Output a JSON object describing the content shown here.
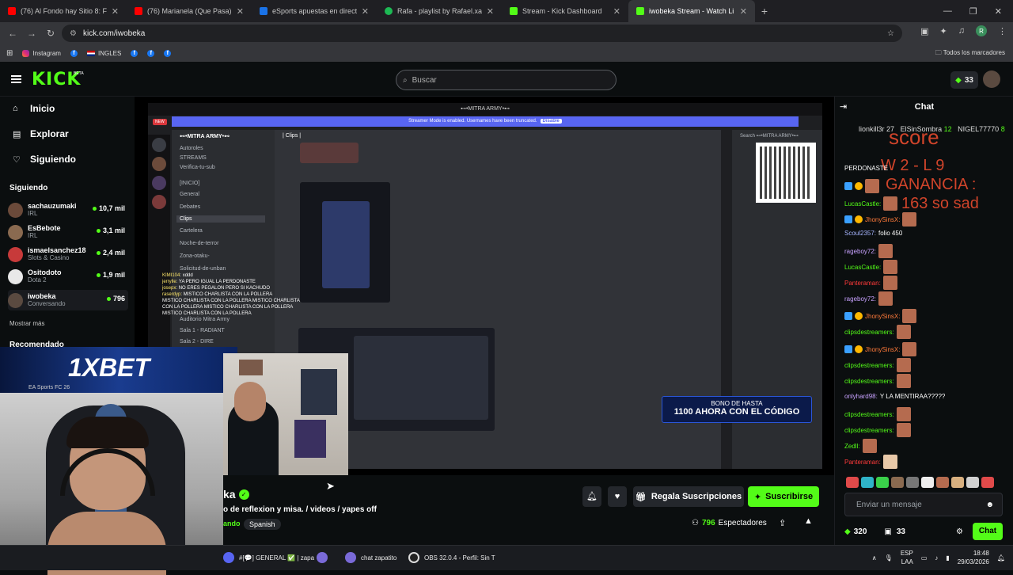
{
  "browser": {
    "tabs": [
      {
        "title": "(76) Al Fondo hay Sitio 8: Ferna",
        "color": "#ff0000",
        "active": false
      },
      {
        "title": "(76) Marianela (Que Pasa) (Exte",
        "color": "#ff0000",
        "active": false
      },
      {
        "title": "eSports apuestas en directo ⊳",
        "color": "#1a73e8",
        "active": false
      },
      {
        "title": "Rafa - playlist by Rafael.xared |",
        "color": "#1db954",
        "active": false
      },
      {
        "title": "Stream - Kick Dashboard",
        "color": "#53fc18",
        "active": false
      },
      {
        "title": "iwobeka Stream - Watch Li",
        "color": "#53fc18",
        "active": true
      }
    ],
    "url": "kick.com/iwobeka",
    "profile_initial": "R",
    "bookmarks": [
      {
        "label": "Instagram",
        "icon": "instagram-icon"
      },
      {
        "label": "",
        "icon": "facebook-icon"
      },
      {
        "label": "INGLES",
        "icon": "flag-icon"
      },
      {
        "label": "",
        "icon": "facebook-icon"
      },
      {
        "label": "",
        "icon": "facebook-icon"
      },
      {
        "label": "",
        "icon": "facebook-icon"
      }
    ],
    "all_bookmarks": "Todos los marcadores"
  },
  "kick": {
    "logo": "KICK",
    "beta": "BETA",
    "search_placeholder": "Buscar",
    "points": "33"
  },
  "sidebar": {
    "nav": [
      {
        "label": "Inicio",
        "icon": "home-icon"
      },
      {
        "label": "Explorar",
        "icon": "explore-icon"
      },
      {
        "label": "Siguiendo",
        "icon": "heart-icon"
      }
    ],
    "following_heading": "Siguiendo",
    "following": [
      {
        "name": "sachauzumaki",
        "category": "IRL",
        "viewers": "10,7 mil",
        "color": "#6b4a3a"
      },
      {
        "name": "EsBebote",
        "category": "IRL",
        "viewers": "3,1 mil",
        "color": "#8a6a50"
      },
      {
        "name": "ismaelsanchez18",
        "category": "Slots & Casino",
        "viewers": "2,4 mil",
        "color": "#c73a3a"
      },
      {
        "name": "Ositodoto",
        "category": "Dota 2",
        "viewers": "1,9 mil",
        "color": "#e8e8e8"
      },
      {
        "name": "iwobeka",
        "category": "Conversando",
        "viewers": "796",
        "color": "#5a4a40"
      }
    ],
    "show_more": "Mostrar más",
    "recommended_heading": "Recomendado",
    "recommended_partial": "EA Sports FC 26"
  },
  "player": {
    "discord_title": "⊷•MITRA ARMY•⊷",
    "streamer_mode": "Streamer Mode is enabled. Usernames have been truncated.",
    "streamer_disable": "Disable",
    "server_name": "⊷•MITRA ARMY•⊷",
    "channel_header": "| Clips |",
    "channels": [
      "Autoroles",
      "STREAMS",
      "Verifica-tu-sub",
      "[INICIO]",
      "General",
      "Debates",
      "Clips",
      "Cartelera",
      "Noche-de-terror",
      "Zona-otaku-",
      "Solicitud-de-unban",
      "Auditorio Mitra Army",
      "Sala 1 - RADIANT",
      "Sala 2 - DIRE"
    ],
    "member_search": "Search ⊷•MITRA ARMY•⊷",
    "overlay_chat": [
      {
        "user": "KIMI104",
        "text": "xddd"
      },
      {
        "user": "jerrylle",
        "text": "YA PERO IGUAL LA PERDONASTE"
      },
      {
        "user": "josepx",
        "text": "NO ERES PEGALON PERO SI KACHUDO"
      },
      {
        "user": "raserdyp",
        "text": "MISTICO CHARLISTA CON LA POLLERA"
      },
      {
        "user": "",
        "text": "MISTICO CHARLISTA CON LA POLLERA MISTICO CHARLISTA CON LA POLLERA MISTICO CHARLISTA CON LA POLLERA MISTICO CHARLISTA CON LA POLLERA"
      }
    ],
    "promo_line1": "BONO DE HASTA",
    "promo_line2": "1100 AHORA CON EL CÓDIGO",
    "sponsor": "1XBET"
  },
  "stream": {
    "name_partial": "ka",
    "title": "o de reflexion y misa.  /  videos / yapes off",
    "category_partial": "ando",
    "language": "Spanish",
    "gift_label": "Regala Suscripciones",
    "subscribe_label": "Suscribirse",
    "viewer_count": "796",
    "viewer_label": "Espectadores"
  },
  "chat": {
    "title": "Chat",
    "pinned": [
      {
        "user": "lionkill3r",
        "extra": "27"
      },
      {
        "user": "ElSinSombra",
        "extra": "12"
      },
      {
        "user": "NIGEL77770",
        "extra": "8"
      }
    ],
    "overlay_text": [
      "score",
      "W 2 - L 9",
      "GANANCIA :",
      "163  so sad"
    ],
    "messages": [
      {
        "user": "PERDONASTE",
        "color": "#ffffff",
        "text": ""
      },
      {
        "user": "",
        "color": "#ff7a3a",
        "text": ""
      },
      {
        "user": "LucasCastle:",
        "color": "#53fc18",
        "text": ""
      },
      {
        "user": "JhonySinsX:",
        "color": "#ff7a3a",
        "text": ""
      },
      {
        "user": "Scoul2357:",
        "color": "#a6b4ff",
        "text": "folio 450"
      },
      {
        "user": "rageboy72:",
        "color": "#c8a2ff",
        "text": ""
      },
      {
        "user": "LucasCastle:",
        "color": "#53fc18",
        "text": ""
      },
      {
        "user": "Panteraman:",
        "color": "#ff3a3a",
        "text": ""
      },
      {
        "user": "rageboy72:",
        "color": "#c8a2ff",
        "text": ""
      },
      {
        "user": "JhonySinsX:",
        "color": "#ff7a3a",
        "text": ""
      },
      {
        "user": "clipsdestreamers:",
        "color": "#53fc18",
        "text": ""
      },
      {
        "user": "JhonySinsX:",
        "color": "#ff7a3a",
        "text": ""
      },
      {
        "user": "clipsdestreamers:",
        "color": "#53fc18",
        "text": ""
      },
      {
        "user": "clipsdestreamers:",
        "color": "#53fc18",
        "text": ""
      },
      {
        "user": "onlyhard98:",
        "color": "#c8a2ff",
        "text": "Y LA MENTIRAA?????"
      },
      {
        "user": "clipsdestreamers:",
        "color": "#53fc18",
        "text": ""
      },
      {
        "user": "clipsdestreamers:",
        "color": "#53fc18",
        "text": ""
      },
      {
        "user": "Zedll:",
        "color": "#53fc18",
        "text": ""
      },
      {
        "user": "Panteraman:",
        "color": "#ff3a3a",
        "text": ""
      }
    ],
    "input_placeholder": "Enviar un mensaje",
    "points": "320",
    "gifts": "33",
    "send_label": "Chat"
  },
  "taskbar": {
    "items": [
      {
        "label": "#[💬] GENERAL ✅ | zapa",
        "icon": "discord-icon"
      },
      {
        "label": "",
        "icon": "app-icon"
      },
      {
        "label": "chat zapatito",
        "icon": "app-icon"
      },
      {
        "label": "OBS 32.0.4 - Perfil: Sin T",
        "icon": "obs-icon"
      }
    ],
    "lang_line1": "ESP",
    "lang_line2": "LAA",
    "time": "18:48",
    "date": "29/03/2026"
  }
}
